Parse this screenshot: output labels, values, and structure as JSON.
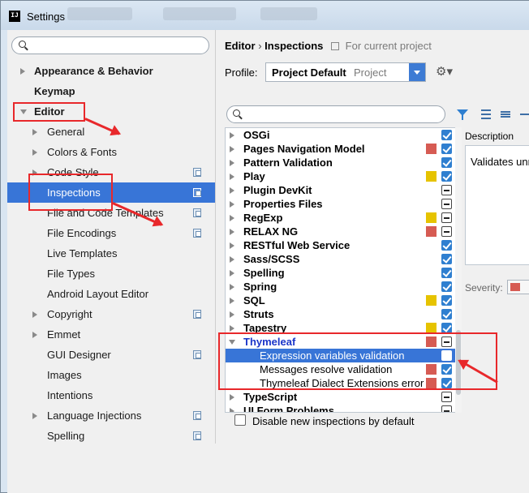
{
  "window": {
    "title": "Settings"
  },
  "sidebar": {
    "search_placeholder": "",
    "items": [
      {
        "label": "Appearance & Behavior",
        "bold": true
      },
      {
        "label": "Keymap",
        "bold": true
      },
      {
        "label": "Editor",
        "bold": true
      },
      {
        "label": "General"
      },
      {
        "label": "Colors & Fonts"
      },
      {
        "label": "Code Style"
      },
      {
        "label": "Inspections"
      },
      {
        "label": "File and Code Templates"
      },
      {
        "label": "File Encodings"
      },
      {
        "label": "Live Templates"
      },
      {
        "label": "File Types"
      },
      {
        "label": "Android Layout Editor"
      },
      {
        "label": "Copyright"
      },
      {
        "label": "Emmet"
      },
      {
        "label": "GUI Designer"
      },
      {
        "label": "Images"
      },
      {
        "label": "Intentions"
      },
      {
        "label": "Language Injections"
      },
      {
        "label": "Spelling"
      }
    ]
  },
  "breadcrumb": {
    "parent": "Editor",
    "separator": "›",
    "current": "Inspections",
    "scope": "For current project"
  },
  "profile": {
    "label": "Profile:",
    "value": "Project Default",
    "scope": "Project"
  },
  "inspections": [
    {
      "name": "OSGi",
      "severity": null,
      "state": "on"
    },
    {
      "name": "Pages Navigation Model",
      "severity": "#d65b53",
      "state": "on"
    },
    {
      "name": "Pattern Validation",
      "severity": null,
      "state": "on"
    },
    {
      "name": "Play",
      "severity": "#e6c300",
      "state": "on"
    },
    {
      "name": "Plugin DevKit",
      "severity": null,
      "state": "partial"
    },
    {
      "name": "Properties Files",
      "severity": null,
      "state": "partial"
    },
    {
      "name": "RegExp",
      "severity": "#e6c300",
      "state": "partial"
    },
    {
      "name": "RELAX NG",
      "severity": "#d65b53",
      "state": "partial"
    },
    {
      "name": "RESTful Web Service",
      "severity": null,
      "state": "on"
    },
    {
      "name": "Sass/SCSS",
      "severity": null,
      "state": "on"
    },
    {
      "name": "Spelling",
      "severity": null,
      "state": "on"
    },
    {
      "name": "Spring",
      "severity": null,
      "state": "on"
    },
    {
      "name": "SQL",
      "severity": "#e6c300",
      "state": "on"
    },
    {
      "name": "Struts",
      "severity": null,
      "state": "on"
    },
    {
      "name": "Tapestry",
      "severity": "#e6c300",
      "state": "on"
    },
    {
      "name": "Thymeleaf",
      "severity": "#d65b53",
      "state": "partial",
      "expanded": true,
      "highlight": true
    },
    {
      "name": "Expression variables validation",
      "severity": null,
      "state": "off",
      "child": true,
      "selected": true
    },
    {
      "name": "Messages resolve validation",
      "severity": "#d65b53",
      "state": "on",
      "child": true
    },
    {
      "name": "Thymeleaf Dialect Extensions error",
      "severity": "#d65b53",
      "state": "on",
      "child": true
    },
    {
      "name": "TypeScript",
      "severity": null,
      "state": "partial"
    },
    {
      "name": "UI Form Problems",
      "severity": null,
      "state": "partial"
    }
  ],
  "description": {
    "label": "Description",
    "text": "Validates unr"
  },
  "severity": {
    "label": "Severity:"
  },
  "options": {
    "disable_new_label": "Disable new inspections by default"
  }
}
